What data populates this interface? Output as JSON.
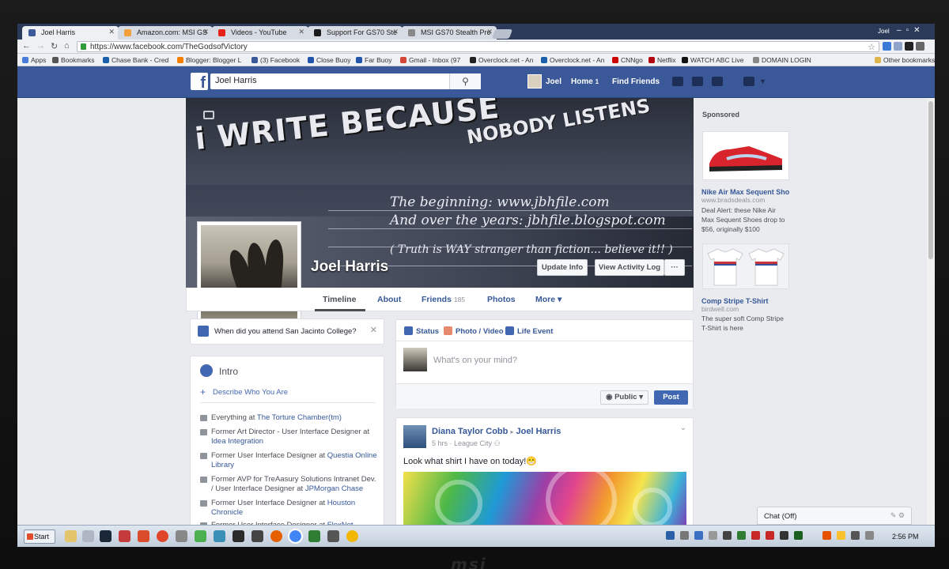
{
  "browser": {
    "tabs": [
      {
        "label": "Joel Harris",
        "favicon_color": "#3b5998"
      },
      {
        "label": "Amazon.com: MSI GS",
        "favicon_color": "#f0a13b"
      },
      {
        "label": "Videos - YouTube",
        "favicon_color": "#e62117"
      },
      {
        "label": "Support For GS70 Ste",
        "favicon_color": "#1a1a1a"
      },
      {
        "label": "MSI GS70 Stealth Pro",
        "favicon_color": "#888888"
      }
    ],
    "profile_name": "Joel",
    "url": "https://www.facebook.com/TheGodsofVictory",
    "bookmarks": [
      {
        "label": "Apps",
        "color": "#4a7bd8"
      },
      {
        "label": "Bookmarks",
        "color": "#555555"
      },
      {
        "label": "Chase Bank - Cred",
        "color": "#1a5fa8"
      },
      {
        "label": "Blogger: Blogger L",
        "color": "#f57d00"
      },
      {
        "label": "(3) Facebook",
        "color": "#3b5998"
      },
      {
        "label": "Close Buoy",
        "color": "#2255aa"
      },
      {
        "label": "Far Buoy",
        "color": "#2255aa"
      },
      {
        "label": "Gmail - Inbox (97",
        "color": "#d44638"
      },
      {
        "label": "Overclock.net - An",
        "color": "#222222"
      },
      {
        "label": "Overclock.net - An",
        "color": "#1a5fa8"
      },
      {
        "label": "CNNgo",
        "color": "#cc0000"
      },
      {
        "label": "Netflix",
        "color": "#b20710"
      },
      {
        "label": "WATCH ABC Live",
        "color": "#111111"
      },
      {
        "label": "DOMAIN LOGIN",
        "color": "#888888"
      }
    ],
    "other_bookmarks": "Other bookmarks"
  },
  "facebook": {
    "search_value": "Joel Harris",
    "nav": {
      "user": "Joel",
      "home": "Home",
      "home_count": "1",
      "find_friends": "Find Friends"
    },
    "cover": {
      "graffiti_main": "i WRITE BECAUSE",
      "graffiti_side": "NOBODY LISTENS",
      "line1": "The beginning: www.jbhfile.com",
      "line2": "And over the years: jbhfile.blogspot.com",
      "line3": "( Truth is WAY stranger than fiction... believe it!! )"
    },
    "profile_name": "Joel Harris",
    "buttons": {
      "update_info": "Update Info",
      "activity_log": "View Activity Log",
      "more": "···"
    },
    "profile_tabs": [
      {
        "label": "Timeline"
      },
      {
        "label": "About"
      },
      {
        "label": "Friends",
        "count": "185"
      },
      {
        "label": "Photos"
      },
      {
        "label": "More ▾"
      }
    ],
    "question": "When did you attend San Jacinto College?",
    "intro": {
      "title": "Intro",
      "describe": "Describe Who You Are",
      "items": [
        {
          "prefix": "Everything at ",
          "link": "The Torture Chamber(tm)",
          "suffix": ""
        },
        {
          "prefix": "Former Art Director - User Interface Designer at ",
          "link": "Idea Integration",
          "suffix": ""
        },
        {
          "prefix": "Former User Interface Designer at ",
          "link": "Questia Online Library",
          "suffix": ""
        },
        {
          "prefix": "Former AVP for TreAasury Solutions Intranet Dev. / User Interface Designer at ",
          "link": "JPMorgan Chase",
          "suffix": ""
        },
        {
          "prefix": "Former User Interface Designer at ",
          "link": "Houston Chronicle",
          "suffix": ""
        },
        {
          "prefix": "Former User Interface Designer at ",
          "link": "FlexNet",
          "suffix": ""
        }
      ]
    },
    "composer": {
      "tabs": [
        "Status",
        "Photo / Video",
        "Life Event"
      ],
      "placeholder": "What's on your mind?",
      "audience": "Public ▾",
      "post_button": "Post"
    },
    "post": {
      "author": "Diana Taylor Cobb",
      "arrow": "▸",
      "target": "Joel Harris",
      "time": "5 hrs",
      "location": "League City",
      "text": "Look what shirt I have on today!😁"
    },
    "sponsored": {
      "heading": "Sponsored",
      "ads": [
        {
          "title": "Nike Air Max Sequent Sho",
          "site": "www.bradsdeals.com",
          "body": "Deal Alert: these Nike Air Max Sequent Shoes drop to $56, originally $100"
        },
        {
          "title": "Comp Stripe T-Shirt",
          "site": "birdwell.com",
          "body": "The super soft Comp Stripe T-Shirt is here"
        }
      ]
    },
    "chat": "Chat (Off)"
  },
  "taskbar": {
    "start": "Start",
    "clock": "2:56 PM"
  },
  "device": {
    "brand": "msi"
  }
}
